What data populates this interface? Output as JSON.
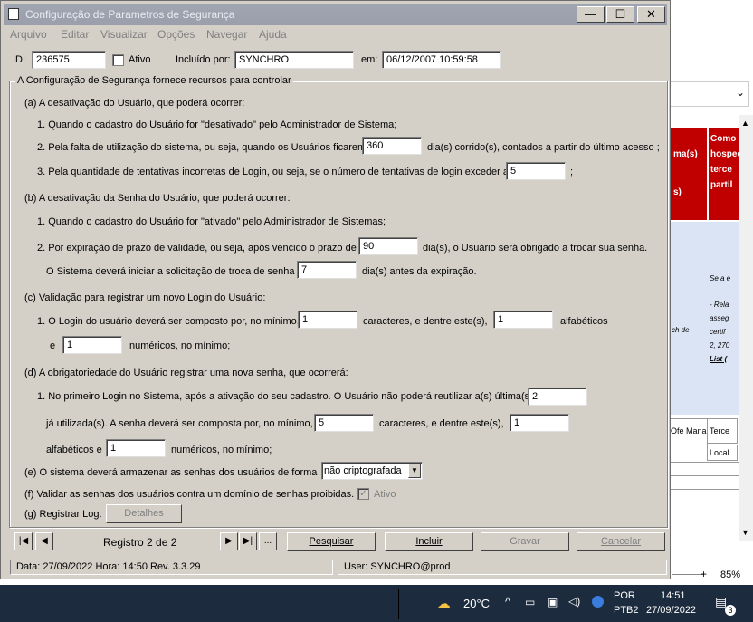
{
  "window": {
    "title": "Configuração de Parametros de Segurança",
    "min": "—",
    "max": "☐",
    "close": "✕"
  },
  "menu": [
    "Arquivo",
    "Editar",
    "Visualizar",
    "Opções",
    "Navegar",
    "Ajuda"
  ],
  "header": {
    "id_label": "ID:",
    "id_value": "236575",
    "active_label": "Ativo",
    "included_by_label": "Incluído por:",
    "included_by_value": "SYNCHRO",
    "on_label": "em:",
    "on_value": "06/12/2007 10:59:58"
  },
  "group_title": "A Configuração de Segurança fornece recursos para controlar",
  "sec_a": {
    "title": "(a) A desativação do Usuário, que poderá ocorrer:",
    "item1": "1. Quando o cadastro do Usuário for \"desativado\" pelo Administrador de Sistema;",
    "item2_pre": "2. Pela falta de utilização do sistema, ou seja, quando os Usuários ficarem",
    "item2_value": "360",
    "item2_post": "dia(s) corrido(s), contados a partir do último acesso ;",
    "item3_pre": "3. Pela quantidade de tentativas incorretas de Login, ou seja, se o número de tentativas de login exceder a",
    "item3_value": "5",
    "item3_post": ";"
  },
  "sec_b": {
    "title": "(b) A desativação da Senha do Usuário, que poderá ocorrer:",
    "item1": "1. Quando o cadastro do Usuário for \"ativado\" pelo Administrador de Sistemas;",
    "item2_pre": "2. Por expiração de prazo de validade, ou seja, após vencido o prazo de",
    "item2_value": "90",
    "item2_post": "dia(s), o Usuário será obrigado a trocar sua senha.",
    "item3_pre": "O Sistema deverá iniciar a solicitação de troca de senha",
    "item3_value": "7",
    "item3_post": "dia(s) antes da expiração."
  },
  "sec_c": {
    "title": "(c) Validação para registrar um novo Login do Usuário:",
    "item1_pre": "1. O Login do usuário deverá ser composto por, no mínimo,",
    "min_chars": "1",
    "mid": "caracteres, e dentre este(s),",
    "alpha": "1",
    "alpha_label": "alfabéticos",
    "e_label": "e",
    "numeric": "1",
    "numeric_label": "numéricos, no mínimo;"
  },
  "sec_d": {
    "title": "(d) A obrigatoriedade do Usuário registrar uma nova senha, que ocorrerá:",
    "item1_pre": "1. No primeiro Login no Sistema, após a ativação do seu cadastro. O Usuário não poderá reutilizar a(s) última(s)",
    "last_n": "2",
    "line2_pre": "já utilizada(s). A senha deverá ser composta por, no mínimo,",
    "min_chars": "5",
    "line2_mid": "caracteres, e dentre este(s),",
    "alpha": "1",
    "line3_pre": "alfabéticos e",
    "numeric": "1",
    "line3_post": "numéricos, no mínimo;"
  },
  "sec_e": {
    "label": "(e) O sistema deverá armazenar as senhas dos usuários de forma",
    "select_value": "não criptografada"
  },
  "sec_f": {
    "label": "(f) Validar as senhas dos usuários contra um domínio de senhas proibidas.",
    "check_label": "Ativo"
  },
  "sec_g": {
    "label": "(g) Registrar Log.",
    "details_button": "Detalhes"
  },
  "nav": {
    "record": "Registro 2 de 2",
    "more": "...",
    "search": "Pesquisar",
    "include": "Incluir",
    "save": "Gravar",
    "cancel": "Cancelar"
  },
  "status": {
    "left": "Data: 27/09/2022   Hora: 14:50   Rev. 3.3.29",
    "right": "User:  SYNCHRO@prod"
  },
  "background": {
    "header_red": "Como hosped terce partil",
    "frag_a": "ma(s)",
    "frag_b": "s)",
    "italic1": "Se a e",
    "italic2": "- Rela",
    "italic3": "asseg",
    "italic4": "certif",
    "italic5": "2, 270",
    "italic6": "List (",
    "italic7": "ch de",
    "cell1": "Ofe Mana",
    "cell2": "Terce",
    "cell3": "Local",
    "zoom": "85%",
    "zoom_plus": "+"
  },
  "taskbar": {
    "temp": "20°C",
    "lang1": "POR",
    "lang2": "PTB2",
    "time": "14:51",
    "date": "27/09/2022",
    "notif": "3"
  }
}
